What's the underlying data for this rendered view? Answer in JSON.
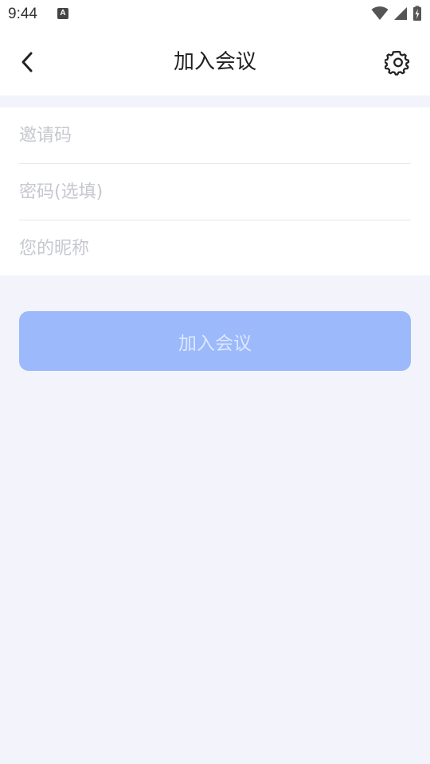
{
  "status_bar": {
    "time": "9:44",
    "notification_icon": "text-a-icon",
    "icons": [
      "wifi-icon",
      "signal-icon",
      "battery-charging-icon"
    ]
  },
  "header": {
    "title": "加入会议",
    "back_icon": "chevron-left-icon",
    "settings_icon": "gear-icon"
  },
  "form": {
    "invite_code": {
      "placeholder": "邀请码",
      "value": ""
    },
    "password": {
      "placeholder": "密码(选填)",
      "value": ""
    },
    "nickname": {
      "placeholder": "您的昵称",
      "value": ""
    }
  },
  "actions": {
    "join_label": "加入会议",
    "join_enabled": false
  },
  "colors": {
    "background": "#f2f3fb",
    "primary_disabled": "#9bb9fb",
    "placeholder": "#c6c8cf"
  }
}
